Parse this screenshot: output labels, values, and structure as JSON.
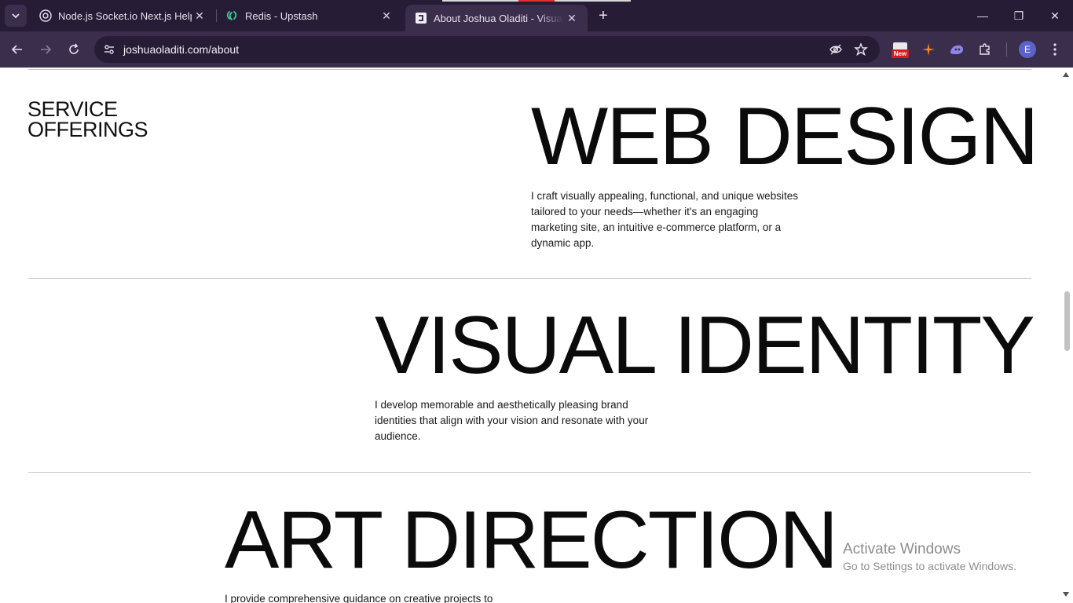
{
  "browser": {
    "tabs": [
      {
        "title": "Node.js Socket.io Next.js Help",
        "icon": "chatgpt-icon"
      },
      {
        "title": "Redis - Upstash",
        "icon": "upstash-icon"
      },
      {
        "title": "About Joshua Oladiti - Visual Designer",
        "icon": "site-icon",
        "active": true
      }
    ],
    "close_glyph": "✕",
    "new_tab_glyph": "+",
    "url": "joshuaoladiti.com/about",
    "profile_initial": "E",
    "ext_badge": "New",
    "window_controls": {
      "minimize": "—",
      "restore": "❐",
      "close": "✕"
    }
  },
  "page": {
    "section_label": "SERVICE OFFERINGS",
    "services": [
      {
        "title": "WEB DESIGN",
        "description": "I craft visually appealing, functional, and unique websites tailored to your needs—whether it's an engaging marketing site, an intuitive e-commerce platform, or a dynamic app."
      },
      {
        "title": "VISUAL IDENTITY",
        "description": "I develop memorable and aesthetically pleasing brand identities that align with your vision and resonate with your audience."
      },
      {
        "title": "ART DIRECTION",
        "description": "I provide comprehensive guidance on creative projects to"
      }
    ]
  },
  "os": {
    "watermark_title": "Activate Windows",
    "watermark_subtitle": "Go to Settings to activate Windows."
  },
  "colors": {
    "tabstrip": "#271c36",
    "toolbar": "#3a2e4c",
    "page_bg": "#ffffff",
    "text": "#0b0b0b"
  }
}
